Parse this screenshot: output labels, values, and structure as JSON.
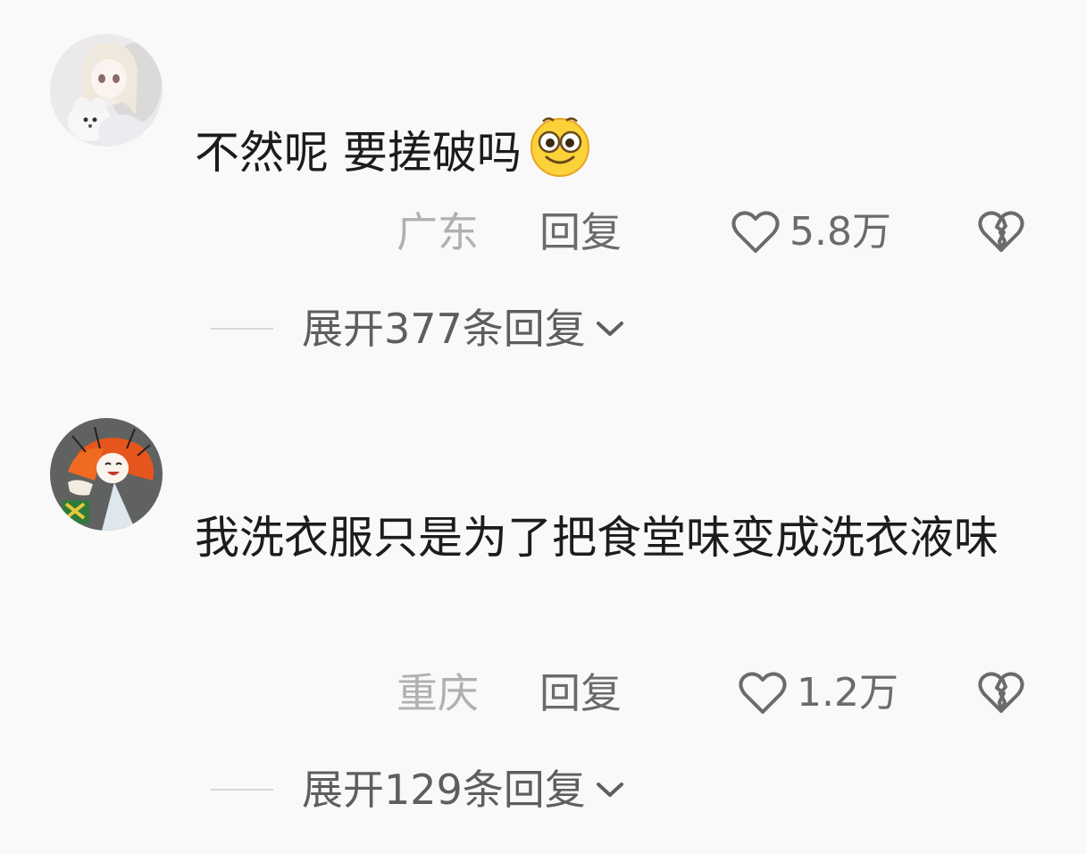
{
  "comments": [
    {
      "text": "不然呢 要搓破吗",
      "emoji": "smiling-face-emoji",
      "location": "广东",
      "reply_label": "回复",
      "like_count": "5.8万",
      "expand_label": "展开377条回复"
    },
    {
      "text": "我洗衣服只是为了把食堂味变成洗衣液味",
      "location": "重庆",
      "reply_label": "回复",
      "like_count": "1.2万",
      "expand_label": "展开129条回复"
    }
  ],
  "icons": {
    "like": "heart-outline-icon",
    "dislike": "broken-heart-icon",
    "expand": "chevron-down-icon"
  },
  "colors": {
    "background": "#f9f9f9",
    "text_primary": "#1c1c1c",
    "text_secondary": "#6b6b6b",
    "text_location": "#b0b0b0"
  }
}
